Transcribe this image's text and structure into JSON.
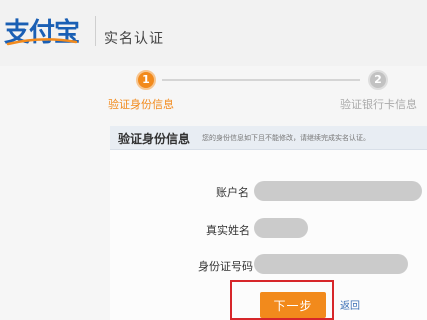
{
  "header": {
    "logo_text": "支付宝",
    "title": "实名认证"
  },
  "steps": [
    {
      "number": "1",
      "label": "验证身份信息",
      "state": "active"
    },
    {
      "number": "2",
      "label": "验证银行卡信息",
      "state": "inactive"
    }
  ],
  "section": {
    "title": "验证身份信息",
    "note": "您的身份信息如下且不能修改，请继续完成实名认证。"
  },
  "form": {
    "fields": [
      {
        "label": "账户名",
        "value_state": "blurred"
      },
      {
        "label": "真实姓名",
        "value_state": "blurred"
      },
      {
        "label": "身份证号码",
        "value_state": "blurred"
      }
    ]
  },
  "actions": {
    "next_label": "下一步",
    "back_label": "返回"
  },
  "colors": {
    "accent": "#f28a1c",
    "brand": "#1a5fb4",
    "highlight_outline": "#d7262a",
    "inactive": "#c2c2c2"
  }
}
